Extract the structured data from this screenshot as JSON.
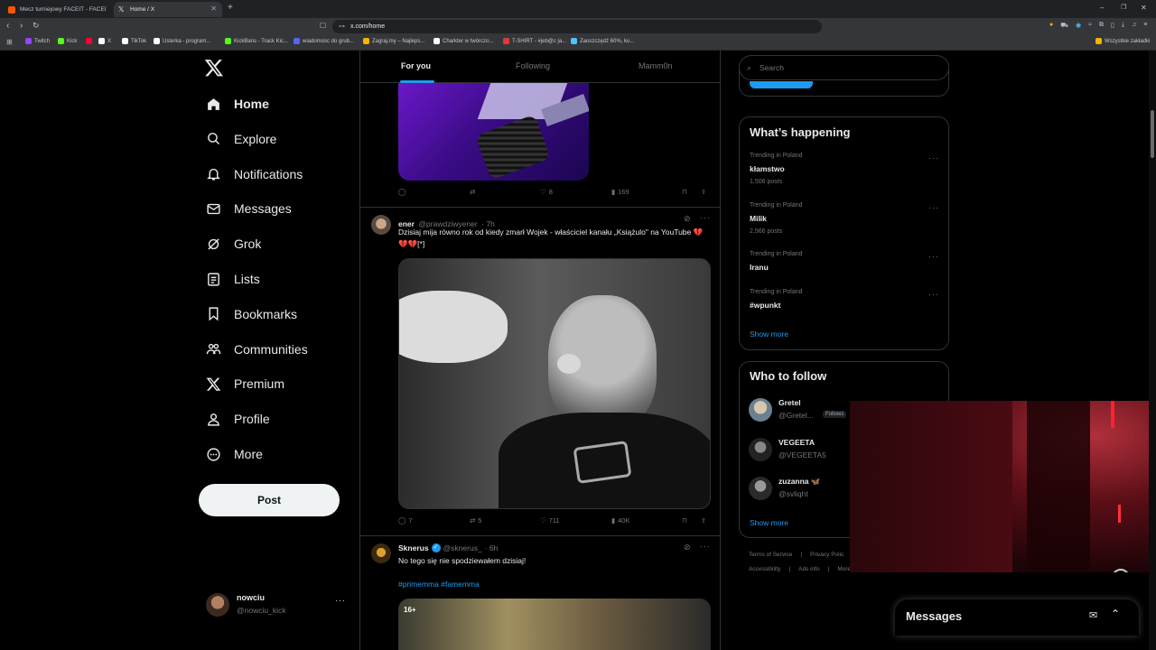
{
  "browser": {
    "tabs": [
      {
        "title": "Mecz turniejowy FACEIT - FACEIT.com",
        "favicon_color": "#ff5500"
      },
      {
        "title": "Home / X",
        "favicon_color": "#e8eaed"
      }
    ],
    "url": "x.com/home",
    "bookmarks": [
      {
        "label": "Twitch",
        "color": "#9146ff"
      },
      {
        "label": "Kick",
        "color": "#53fc18"
      },
      {
        "label": "",
        "color": "#ff0033"
      },
      {
        "label": "X",
        "color": "#ffffff"
      },
      {
        "label": "TikTok",
        "color": "#ffffff"
      },
      {
        "label": "Usterka - program...",
        "color": "#ffffff"
      },
      {
        "label": "KickBans - Track Kic...",
        "color": "#53fc18"
      },
      {
        "label": "wiadomosc do grub...",
        "color": "#5865f2"
      },
      {
        "label": "Zagraj.my – Najleps...",
        "color": "#f4b400"
      },
      {
        "label": "Charkter w twórczo...",
        "color": "#ffffff"
      },
      {
        "label": "T-SHIRT - #jeb@c ja...",
        "color": "#e53935"
      },
      {
        "label": "Zaoszczędź 60%, ku...",
        "color": "#4fc3f7"
      }
    ],
    "all_bookmarks": "Wszystkie zakładki"
  },
  "nav": {
    "items": [
      {
        "label": "Home",
        "icon": "home-icon"
      },
      {
        "label": "Explore",
        "icon": "search-icon"
      },
      {
        "label": "Notifications",
        "icon": "bell-icon"
      },
      {
        "label": "Messages",
        "icon": "envelope-icon"
      },
      {
        "label": "Grok",
        "icon": "grok-icon"
      },
      {
        "label": "Lists",
        "icon": "list-icon"
      },
      {
        "label": "Bookmarks",
        "icon": "bookmark-icon"
      },
      {
        "label": "Communities",
        "icon": "people-icon"
      },
      {
        "label": "Premium",
        "icon": "x-logo-icon"
      },
      {
        "label": "Profile",
        "icon": "person-icon"
      },
      {
        "label": "More",
        "icon": "more-circle-icon"
      }
    ],
    "post_label": "Post",
    "account": {
      "name": "nowciu",
      "handle": "@nowciu_kick"
    }
  },
  "feed": {
    "tabs": [
      "For you",
      "Following",
      "Mamm0n"
    ],
    "prev_tweet": {
      "replies": "",
      "retweets": "",
      "likes": "8",
      "views": "169"
    },
    "tweet1": {
      "name": "ener",
      "handle": "@prawdziwyener",
      "time": "· 7h",
      "text": "Dzisiaj mija równo rok od kiedy zmarł Wojek - właściciel kanału „Książulo\" na YouTube 💔💔💔[*]",
      "replies": "7",
      "retweets": "5",
      "likes": "711",
      "views": "40K"
    },
    "tweet2": {
      "name": "Sknerus",
      "handle": "@sknerus_",
      "time": "· 6h",
      "text": "No tego się nie spodziewałem dzisiaj!",
      "hashtags": "#primemma #famemma",
      "badge": "16+"
    }
  },
  "right": {
    "search_placeholder": "Search",
    "happening_title": "What’s happening",
    "trends": [
      {
        "context": "Trending in Poland",
        "name": "kłamstwo",
        "count": "1,506 posts"
      },
      {
        "context": "Trending in Poland",
        "name": "Milik",
        "count": "2,566 posts"
      },
      {
        "context": "Trending in Poland",
        "name": "Iranu",
        "count": ""
      },
      {
        "context": "Trending in Poland",
        "name": "#wpunkt",
        "count": ""
      }
    ],
    "show_more": "Show more",
    "follow_title": "Who to follow",
    "follows": [
      {
        "name": "Gretel",
        "handle": "@Gretel...",
        "badge": "Follows"
      },
      {
        "name": "VEGEETA",
        "handle": "@VEGEETA5",
        "badge": ""
      },
      {
        "name": "zuzanna 🦋",
        "handle": "@svliqht",
        "badge": ""
      }
    ],
    "footer_row1": [
      "Terms of Service",
      "Privacy Polic"
    ],
    "footer_row2": [
      "Accessibility",
      "Ads info",
      "More ·"
    ]
  },
  "messages_drawer": {
    "title": "Messages"
  }
}
